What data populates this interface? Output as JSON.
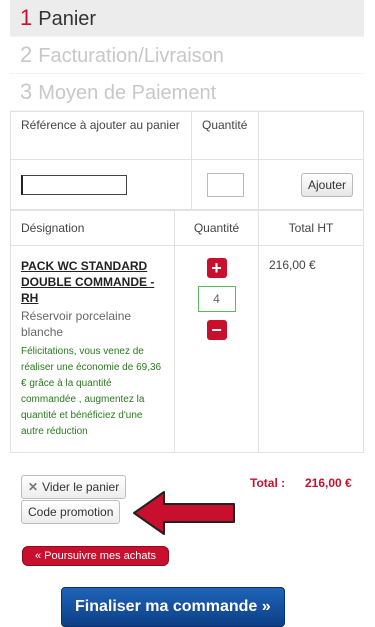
{
  "steps": [
    {
      "num": "1",
      "label": "Panier"
    },
    {
      "num": "2",
      "label": "Facturation/Livraison"
    },
    {
      "num": "3",
      "label": "Moyen de Paiement"
    }
  ],
  "add_form": {
    "ref_label": "Référence à ajouter au panier",
    "qty_label": "Quantité",
    "ref_value": "",
    "qty_value": "",
    "add_button": "Ajouter"
  },
  "cart": {
    "headers": {
      "designation": "Désignation",
      "quantity": "Quantité",
      "total": "Total HT"
    },
    "item": {
      "name": "PACK WC STANDARD DOUBLE COMMANDE - RH",
      "description": "Réservoir porcelaine blanche",
      "promo_message": "Félicitations, vous venez de réaliser une économie de 69,36 € grâce à la quantité commandée , augmentez la quantité et bénéficiez d'une autre réduction",
      "quantity": "4",
      "total": "216,00 €"
    }
  },
  "actions": {
    "empty_cart": "Vider le panier",
    "promo_code": "Code promotion",
    "total_label": "Total :",
    "total_value": "216,00 €",
    "continue_shopping": "« Poursuivre mes achats",
    "checkout": "Finaliser ma commande »"
  },
  "icons": {
    "plus": "plus-icon",
    "minus": "minus-icon",
    "close": "close-icon",
    "arrow": "arrow-left-icon"
  },
  "colors": {
    "accent_red": "#c8102e",
    "checkout_blue": "#1a5aab",
    "promo_green": "#2a7a1e"
  }
}
